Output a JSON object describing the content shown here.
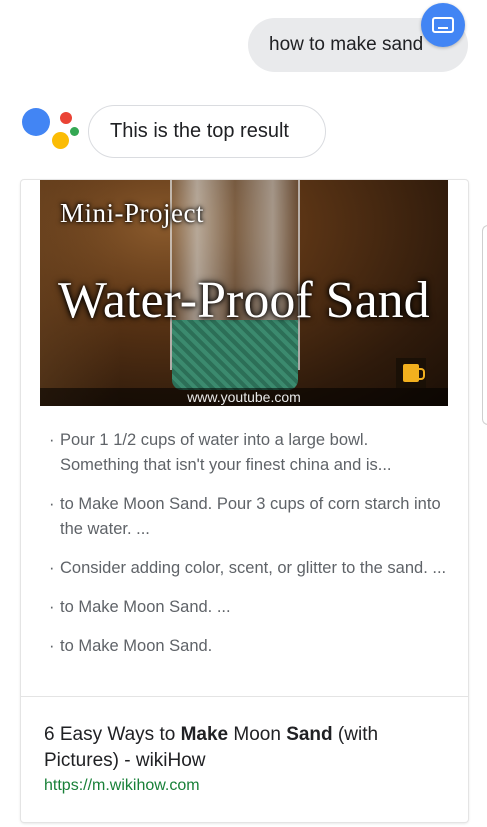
{
  "user_query": "how to make sand",
  "assistant_reply": "This is the top result",
  "result": {
    "thumbnail": {
      "line1": "Mini-Project",
      "line2": "Water-Proof Sand",
      "source": "www.youtube.com"
    },
    "snippets": [
      "Pour 1 1/2 cups of water into a large bowl. Something that isn't your finest china and is...",
      "to Make Moon Sand. Pour 3 cups of corn starch into the water. ...",
      "Consider adding color, scent, or glitter to the sand. ...",
      "to Make Moon Sand. ...",
      "to Make Moon Sand."
    ],
    "title_parts": {
      "p1": "6 Easy Ways to ",
      "b1": "Make",
      "p2": " Moon ",
      "b2": "Sand",
      "p3": " (with Pictures) - wikiHow"
    },
    "url": "https://m.wikihow.com"
  },
  "colors": {
    "assistant_blue": "#4285f4",
    "assistant_red": "#ea4335",
    "assistant_yellow": "#fbbc05",
    "assistant_green": "#34a853",
    "url_green": "#188038"
  },
  "icons": {
    "keyboard": "keyboard-icon"
  }
}
